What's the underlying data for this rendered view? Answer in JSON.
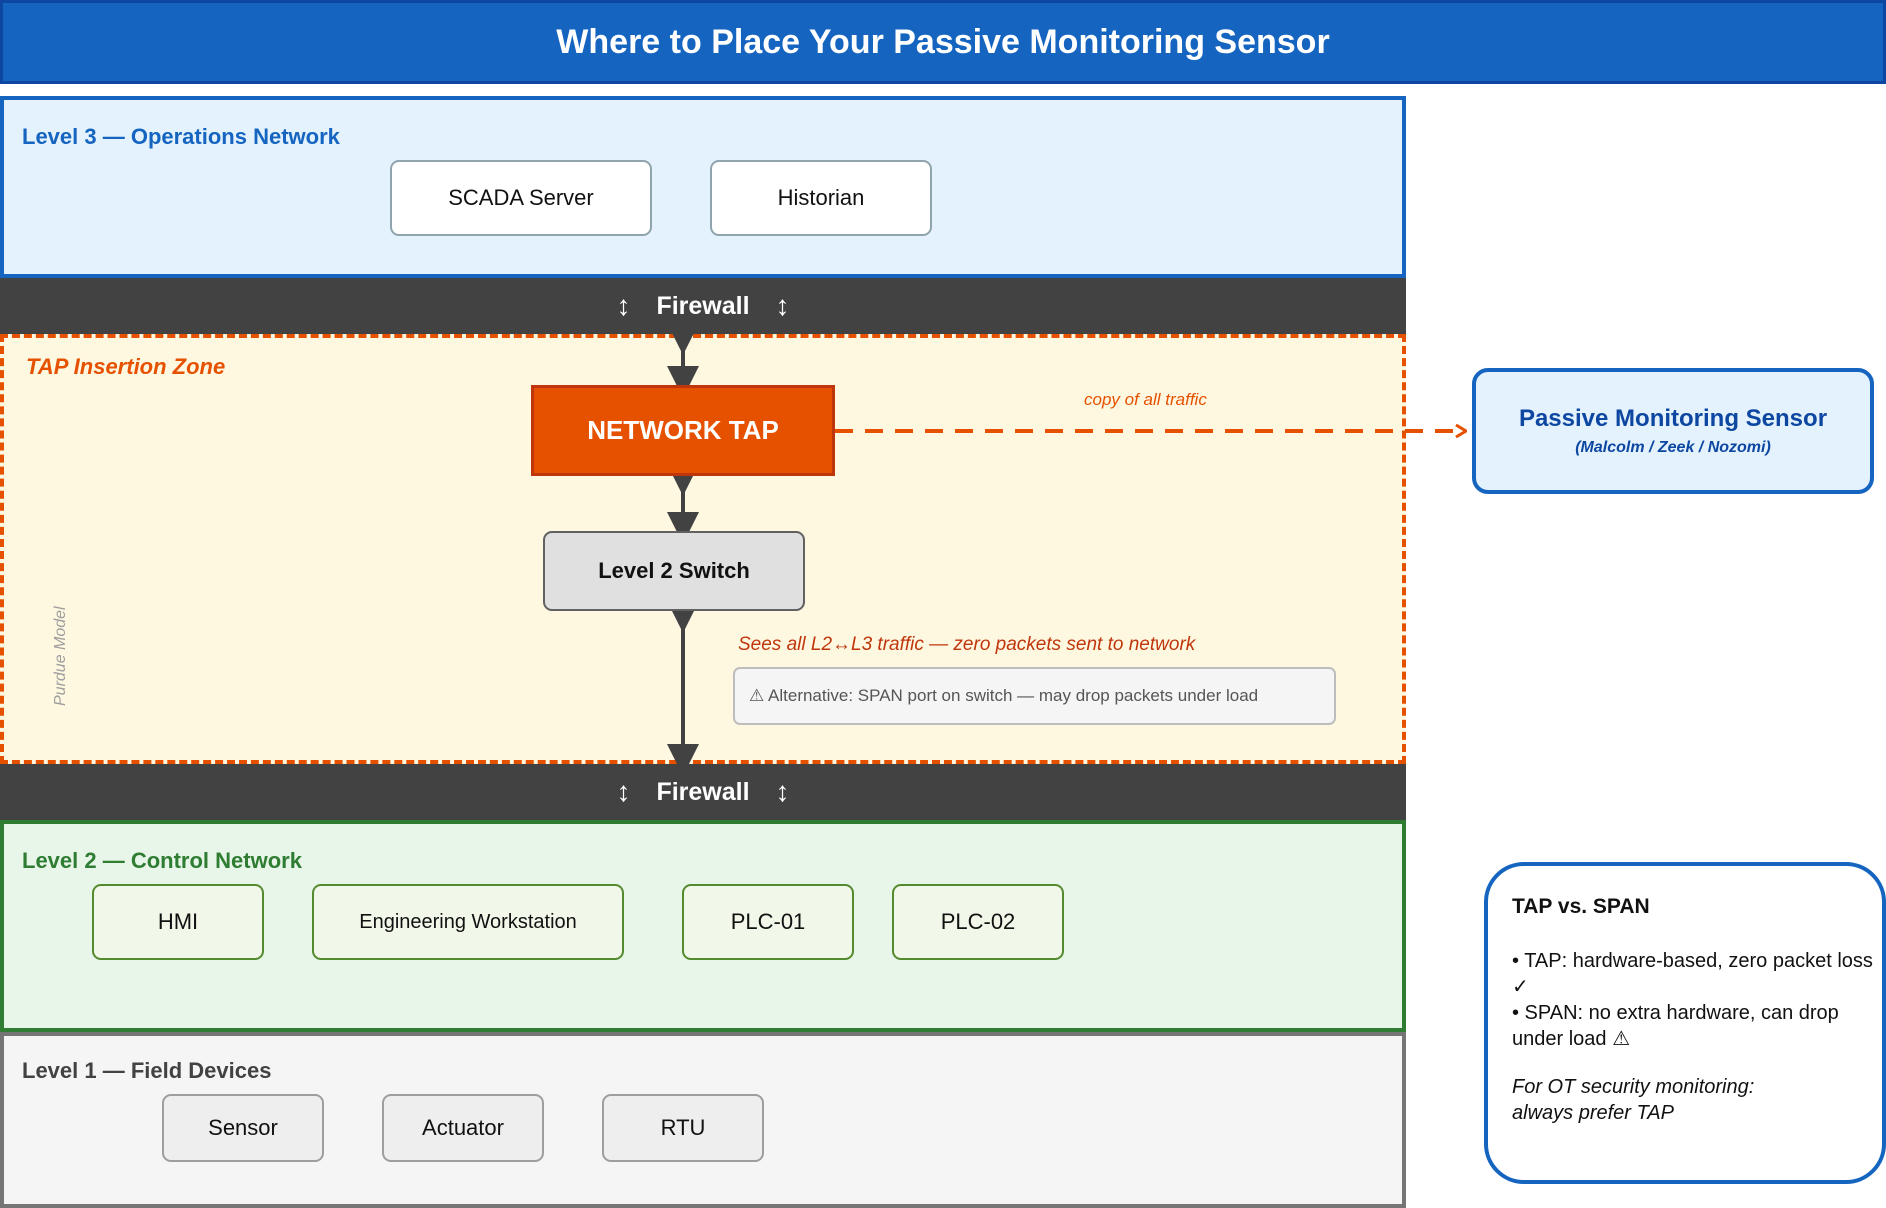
{
  "title": "Where to Place Your Passive Monitoring Sensor",
  "zones": {
    "level3": {
      "label": "Level 3 — Operations Network",
      "devices": [
        "SCADA Server",
        "Historian"
      ]
    },
    "tap_zone": {
      "label": "TAP Insertion Zone"
    },
    "level2": {
      "label": "Level 2 — Control Network",
      "devices": [
        "HMI",
        "Engineering Workstation",
        "PLC-01",
        "PLC-02"
      ]
    },
    "level1": {
      "label": "Level 1 — Field Devices",
      "devices": [
        "Sensor",
        "Actuator",
        "RTU"
      ]
    }
  },
  "firewall": {
    "label": "Firewall",
    "arrow": "↕"
  },
  "network_tap": "NETWORK TAP",
  "level2_switch": "Level 2 Switch",
  "copy_label": "copy of all traffic",
  "sees_label": "Sees all L2↔L3 traffic — zero packets sent to network",
  "alternative_note": "⚠ Alternative: SPAN port on switch — may drop packets under load",
  "purdue_label": "Purdue Model",
  "sensor": {
    "title": "Passive Monitoring Sensor",
    "subtitle": "(Malcolm / Zeek / Nozomi)"
  },
  "comparison": {
    "title": "TAP vs. SPAN",
    "tap_line": "• TAP: hardware-based, zero packet loss ✓",
    "span_line": "• SPAN: no extra hardware, can drop under load ⚠",
    "footer_line1": "For OT security monitoring:",
    "footer_line2": "always prefer TAP"
  },
  "colors": {
    "title_blue": "#1565c0",
    "tap_orange": "#e65100",
    "level2_green": "#2e7d32",
    "firewall_dark": "#424242"
  }
}
